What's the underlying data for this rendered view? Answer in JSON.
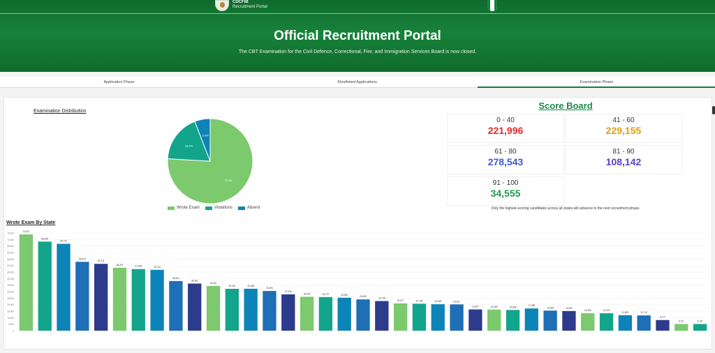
{
  "header": {
    "logo_line1": "CDCFIB",
    "logo_line2": "Recruitment Portal",
    "title": "Official Recruitment Portal",
    "notice": "The CBT Examination for the Civil Defence, Correctional, Fire, and Immigration Services Board is now closed."
  },
  "tabs": [
    {
      "label": "Application Phase",
      "active": false
    },
    {
      "label": "Shortlisted Applications",
      "active": false
    },
    {
      "label": "Examination Phase",
      "active": true
    }
  ],
  "distribution": {
    "title": "Examination Distribution",
    "legend": [
      "Wrote Exam",
      "Violations",
      "Absent"
    ]
  },
  "scoreboard": {
    "title": "Score Board",
    "ranges": [
      {
        "range": "0 - 40",
        "count": "221,996",
        "color": "#e02a2a"
      },
      {
        "range": "41 - 60",
        "count": "229,155",
        "color": "#d9a21a"
      },
      {
        "range": "61 - 80",
        "count": "278,543",
        "color": "#3c5bd6"
      },
      {
        "range": "81 - 90",
        "count": "108,142",
        "color": "#5a3fc9"
      },
      {
        "range": "91 - 100",
        "count": "34,555",
        "color": "#1f9a4c"
      }
    ],
    "note": "Only the highest-scoring candidates across all states will advance to the next recruitment phase."
  },
  "colors": {
    "light_green": "#7cc96e",
    "teal": "#12a58c",
    "blue": "#0d84b8",
    "navy": "#2d3b8c",
    "cerulean": "#1e6fb5"
  },
  "chart_data": [
    {
      "type": "pie",
      "categories": [
        "Wrote Exam",
        "Violations",
        "Absent"
      ],
      "values": [
        75.9,
        18.2,
        5.9
      ],
      "slice_labels": [
        "75.9%",
        "18.2%",
        "5.9%"
      ],
      "colors": [
        "#7cc96e",
        "#12a58c",
        "#0d84b8"
      ]
    },
    {
      "type": "bar",
      "title": "Wrote Exam By State",
      "ylim": [
        0,
        75000
      ],
      "yticks": [
        "0",
        "5,000",
        "10,000",
        "15,000",
        "20,000",
        "25,000",
        "30,000",
        "35,000",
        "40,000",
        "45,000",
        "50,000",
        "55,000",
        "60,000",
        "65,000",
        "70,000",
        "75,000"
      ],
      "values": [
        73947,
        68406,
        66722,
        52876,
        51311,
        48297,
        47283,
        46734,
        38091,
        36181,
        34367,
        32134,
        32188,
        30495,
        27915,
        26044,
        25797,
        25309,
        24005,
        22746,
        20977,
        20706,
        20295,
        20191,
        16307,
        16189,
        15896,
        17056,
        15396,
        15091,
        13383,
        13379,
        11893,
        11712,
        8177,
        5121,
        5102
      ],
      "data_labels": [
        "73,947",
        "68,406",
        "66,722",
        "52,876",
        "51,311",
        "48,297",
        "47,283",
        "46,734",
        "38,091",
        "36,181",
        "34,367",
        "32,134",
        "32,188",
        "30,495",
        "27,915",
        "26,044",
        "25,797",
        "25,309",
        "24,005",
        "22,746",
        "20,977",
        "20,706",
        "20,295",
        "20,191",
        "16,307",
        "16,189",
        "15,896",
        "17,056",
        "15,396",
        "15,091",
        "13,383",
        "13,379",
        "11,893",
        "11,712",
        "8,177",
        "5,121",
        "5,102"
      ],
      "colors": [
        "#7cc96e",
        "#12a58c",
        "#0d84b8",
        "#1e6fb5",
        "#2d3b8c",
        "#7cc96e",
        "#12a58c",
        "#0d84b8",
        "#1e6fb5",
        "#2d3b8c",
        "#7cc96e",
        "#12a58c",
        "#0d84b8",
        "#1e6fb5",
        "#2d3b8c",
        "#7cc96e",
        "#12a58c",
        "#0d84b8",
        "#1e6fb5",
        "#2d3b8c",
        "#7cc96e",
        "#12a58c",
        "#0d84b8",
        "#1e6fb5",
        "#2d3b8c",
        "#7cc96e",
        "#12a58c",
        "#0d84b8",
        "#1e6fb5",
        "#2d3b8c",
        "#7cc96e",
        "#12a58c",
        "#0d84b8",
        "#1e6fb5",
        "#2d3b8c",
        "#7cc96e",
        "#12a58c"
      ]
    }
  ]
}
